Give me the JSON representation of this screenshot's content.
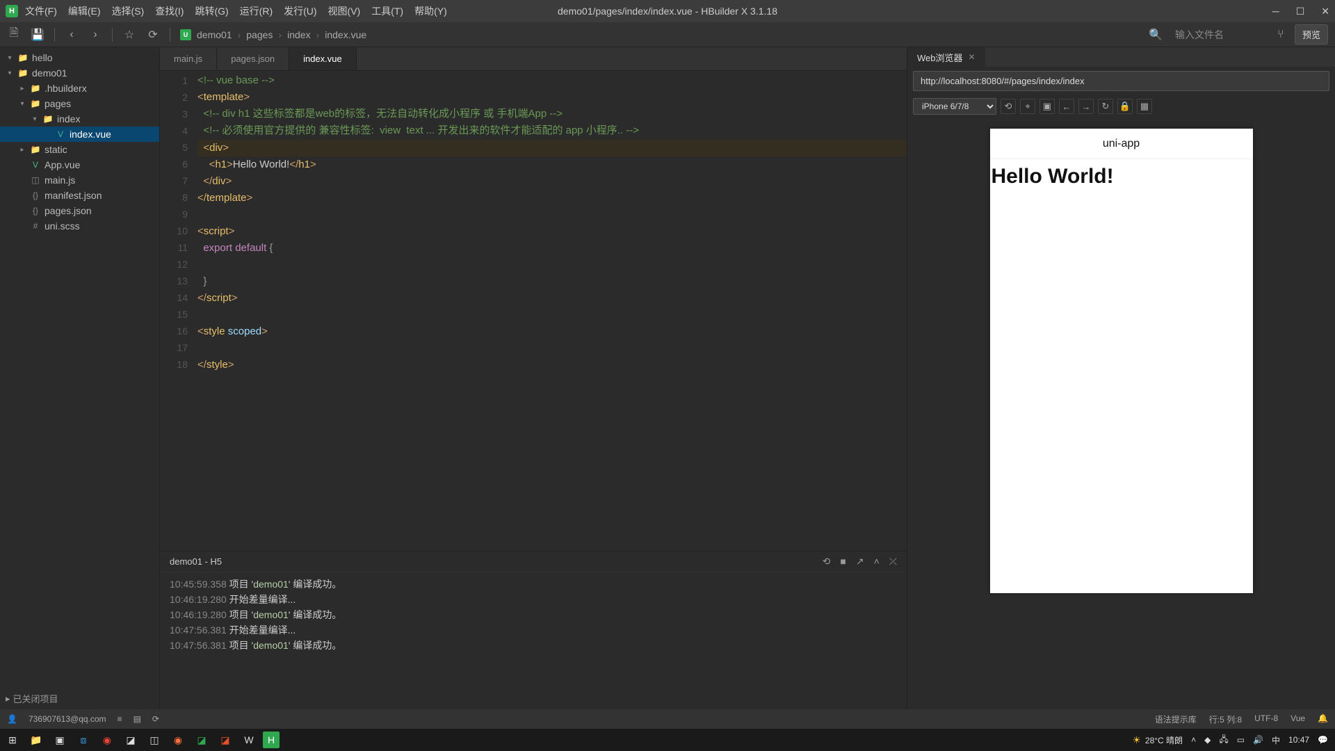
{
  "window_title": "demo01/pages/index/index.vue - HBuilder X 3.1.18",
  "menu": {
    "file": "文件(F)",
    "edit": "编辑(E)",
    "select": "选择(S)",
    "find": "查找(I)",
    "goto": "跳转(G)",
    "run": "运行(R)",
    "publish": "发行(U)",
    "view": "视图(V)",
    "tools": "工具(T)",
    "help": "帮助(Y)"
  },
  "toolbar": {
    "search_placeholder": "输入文件名",
    "preview": "预览"
  },
  "breadcrumb": [
    "demo01",
    "pages",
    "index",
    "index.vue"
  ],
  "sidebar": {
    "items": [
      {
        "label": "hello",
        "type": "folder",
        "indent": 0,
        "expanded": true
      },
      {
        "label": "demo01",
        "type": "folder",
        "indent": 0,
        "expanded": true
      },
      {
        "label": ".hbuilderx",
        "type": "folder",
        "indent": 1,
        "expanded": false
      },
      {
        "label": "pages",
        "type": "folder",
        "indent": 1,
        "expanded": true
      },
      {
        "label": "index",
        "type": "folder",
        "indent": 2,
        "expanded": true
      },
      {
        "label": "index.vue",
        "type": "file",
        "indent": 3,
        "active": true
      },
      {
        "label": "static",
        "type": "folder",
        "indent": 1,
        "expanded": false
      },
      {
        "label": "App.vue",
        "type": "file",
        "indent": 1
      },
      {
        "label": "main.js",
        "type": "file",
        "indent": 1
      },
      {
        "label": "manifest.json",
        "type": "file",
        "indent": 1
      },
      {
        "label": "pages.json",
        "type": "file",
        "indent": 1
      },
      {
        "label": "uni.scss",
        "type": "file",
        "indent": 1
      }
    ],
    "closed": "已关闭项目"
  },
  "tabs": [
    {
      "label": "main.js",
      "active": false
    },
    {
      "label": "pages.json",
      "active": false
    },
    {
      "label": "index.vue",
      "active": true
    }
  ],
  "code_lines": [
    "<!-- vue base -->",
    "<template>",
    "  <!-- div h1 这些标签都是web的标签，无法自动转化成小程序 或 手机端App -->",
    "  <!-- 必须使用官方提供的 兼容性标签:  view  text ... 开发出来的软件才能适配的 app 小程序.. -->",
    "  <div>",
    "    <h1>Hello World!</h1>",
    "  </div>",
    "</template>",
    "",
    "<script>",
    "  export default {",
    "    ",
    "  }",
    "</script>",
    "",
    "<style scoped>",
    "",
    "</style>"
  ],
  "console": {
    "title": "demo01 - H5",
    "lines": [
      {
        "ts": "10:45:59.358",
        "msg": "项目 'demo01' 编译成功。"
      },
      {
        "ts": "10:46:19.280",
        "msg": "开始差量编译..."
      },
      {
        "ts": "10:46:19.280",
        "msg": "项目 'demo01' 编译成功。"
      },
      {
        "ts": "10:47:56.381",
        "msg": "开始差量编译..."
      },
      {
        "ts": "10:47:56.381",
        "msg": "项目 'demo01' 编译成功。"
      }
    ]
  },
  "browser": {
    "tab_title": "Web浏览器",
    "url": "http://localhost:8080/#/pages/index/index",
    "device": "iPhone 6/7/8",
    "app_title": "uni-app",
    "page_heading": "Hello World!"
  },
  "status": {
    "user": "736907613@qq.com",
    "syntax": "语法提示库",
    "cursor": "行:5  列:8",
    "encoding": "UTF-8",
    "lang": "Vue"
  },
  "taskbar": {
    "weather": "28°C 晴朗",
    "ime": "中",
    "time": "10:47"
  }
}
